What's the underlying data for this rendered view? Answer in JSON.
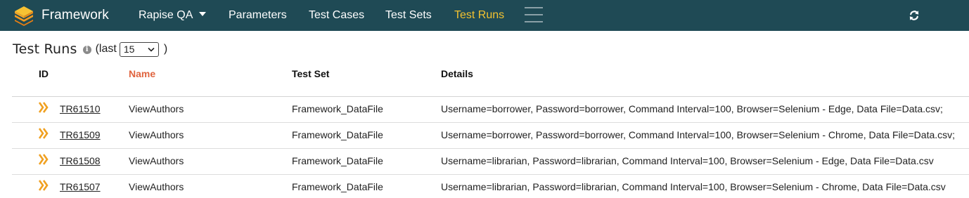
{
  "navbar": {
    "brand": "Framework",
    "items": [
      {
        "label": "Rapise QA",
        "dropdown": true,
        "active": false
      },
      {
        "label": "Parameters",
        "active": false
      },
      {
        "label": "Test Cases",
        "active": false
      },
      {
        "label": "Test Sets",
        "active": false
      },
      {
        "label": "Test Runs",
        "active": true
      }
    ],
    "menu_icon": "hamburger-menu-icon",
    "refresh_icon": "refresh-icon"
  },
  "header": {
    "title": "Test Runs",
    "info_icon": "info-icon",
    "last_label": "(last",
    "last_value": "15",
    "close_paren": ")"
  },
  "table": {
    "columns": [
      "ID",
      "Name",
      "Test Set",
      "Details"
    ],
    "sorted_column": "Name",
    "rows": [
      {
        "id": "TR61510",
        "name": "ViewAuthors",
        "test_set": "Framework_DataFile",
        "details": "Username=borrower, Password=borrower, Command Interval=100, Browser=Selenium - Edge, Data File=Data.csv;"
      },
      {
        "id": "TR61509",
        "name": "ViewAuthors",
        "test_set": "Framework_DataFile",
        "details": "Username=borrower, Password=borrower, Command Interval=100, Browser=Selenium - Chrome, Data File=Data.csv;"
      },
      {
        "id": "TR61508",
        "name": "ViewAuthors",
        "test_set": "Framework_DataFile",
        "details": "Username=librarian, Password=librarian, Command Interval=100, Browser=Selenium - Edge, Data File=Data.csv"
      },
      {
        "id": "TR61507",
        "name": "ViewAuthors",
        "test_set": "Framework_DataFile",
        "details": "Username=librarian, Password=librarian, Command Interval=100, Browser=Selenium - Chrome, Data File=Data.csv"
      }
    ]
  },
  "colors": {
    "navbar": "#1f4a55",
    "active_nav": "#f3c230",
    "sorted_header": "#e0643f",
    "run_icon": "#f0a020"
  }
}
